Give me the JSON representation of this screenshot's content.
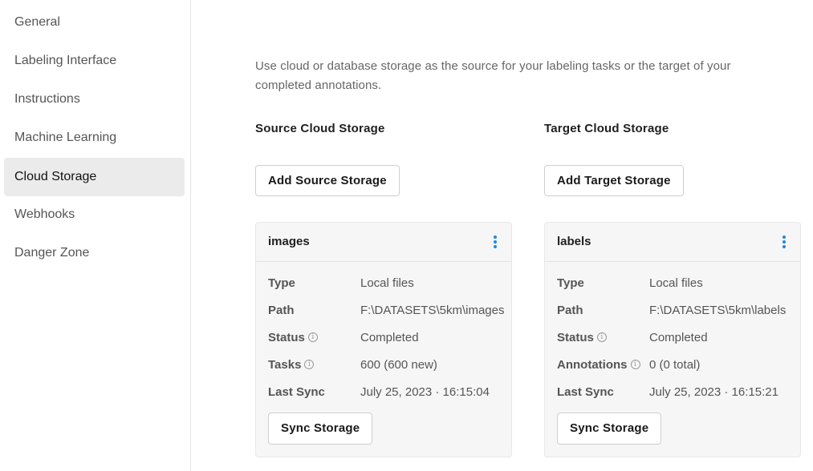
{
  "sidebar": {
    "items": [
      {
        "label": "General"
      },
      {
        "label": "Labeling Interface"
      },
      {
        "label": "Instructions"
      },
      {
        "label": "Machine Learning"
      },
      {
        "label": "Cloud Storage",
        "active": true
      },
      {
        "label": "Webhooks"
      },
      {
        "label": "Danger Zone"
      }
    ]
  },
  "main": {
    "intro": "Use cloud or database storage as the source for your labeling tasks or the target of your completed annotations.",
    "source": {
      "title": "Source Cloud Storage",
      "add_button": "Add Source Storage",
      "card": {
        "name": "images",
        "rows": [
          {
            "label": "Type",
            "value": "Local files"
          },
          {
            "label": "Path",
            "value": "F:\\DATASETS\\5km\\images"
          },
          {
            "label": "Status",
            "value": "Completed"
          },
          {
            "label": "Tasks",
            "value": "600 (600 new)"
          },
          {
            "label": "Last Sync",
            "value": "July 25, 2023 · 16:15:04"
          }
        ],
        "sync_button": "Sync Storage"
      }
    },
    "target": {
      "title": "Target Cloud Storage",
      "add_button": "Add Target Storage",
      "card": {
        "name": "labels",
        "rows": [
          {
            "label": "Type",
            "value": "Local files"
          },
          {
            "label": "Path",
            "value": "F:\\DATASETS\\5km\\labels"
          },
          {
            "label": "Status",
            "value": "Completed"
          },
          {
            "label": "Annotations",
            "value": "0 (0 total)"
          },
          {
            "label": "Last Sync",
            "value": "July 25, 2023 · 16:15:21"
          }
        ],
        "sync_button": "Sync Storage"
      }
    }
  },
  "icons": {
    "info": "i",
    "more": "vertical-dots"
  },
  "colors": {
    "accent": "#1e88e5",
    "active_nav_bg": "#ebebeb"
  }
}
